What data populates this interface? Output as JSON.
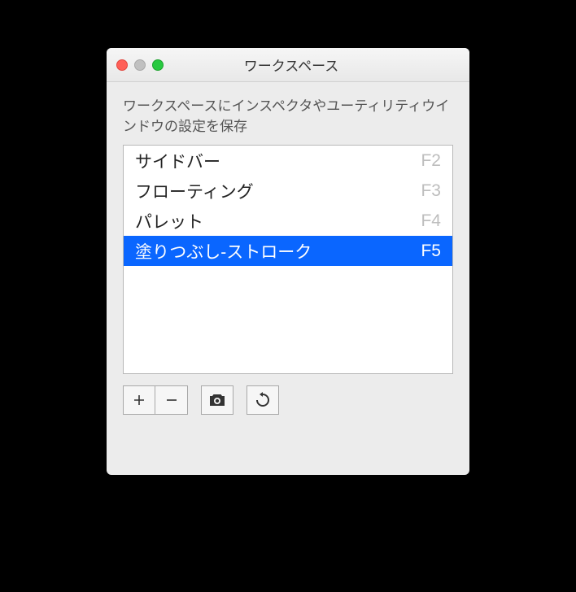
{
  "window": {
    "title": "ワークスペース"
  },
  "description": "ワークスペースにインスペクタやユーティリティウインドウの設定を保存",
  "list": {
    "items": [
      {
        "label": "サイドバー",
        "shortcut": "F2",
        "selected": false
      },
      {
        "label": "フローティング",
        "shortcut": "F3",
        "selected": false
      },
      {
        "label": "パレット",
        "shortcut": "F4",
        "selected": false
      },
      {
        "label": "塗りつぶし-ストローク",
        "shortcut": "F5",
        "selected": true
      }
    ]
  }
}
